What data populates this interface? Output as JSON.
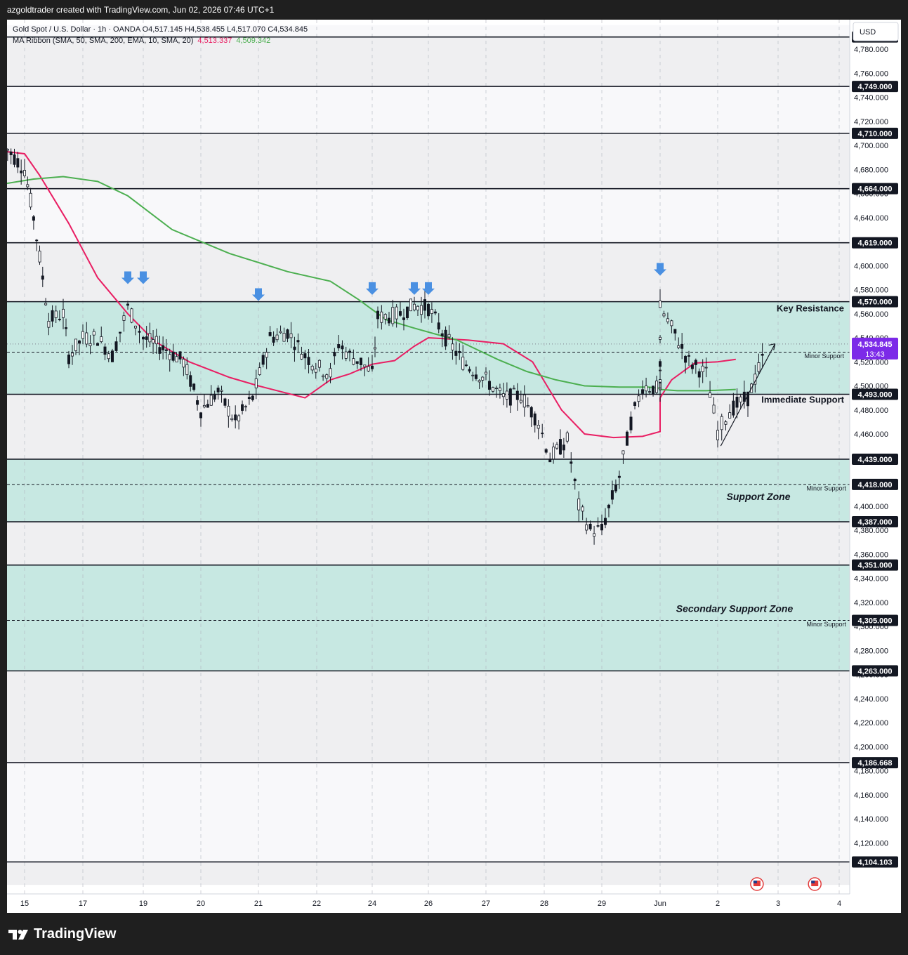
{
  "header": {
    "credit": "azgoldtrader created with TradingView.com, Jun 02, 2026 07:46 UTC+1"
  },
  "legend": {
    "symbol_line": "Gold Spot / U.S. Dollar · 1h · OANDA  O4,517.145  H4,538.455  L4,517.070  C4,534.845",
    "ribbon_label": "MA Ribbon (SMA, 50, SMA, 200, EMA, 10, SMA, 20)",
    "ma_fast_value": "4,513.337",
    "ma_slow_value": "4,509.342"
  },
  "currency": "USD",
  "brand": {
    "name": "TradingView"
  },
  "colors": {
    "zone_fill": "#c7e8e2",
    "band_light": "#f8f8fa",
    "band_dark": "#efeff1",
    "level_line": "#131722",
    "ma_fast": "#e91e63",
    "ma_slow": "#4caf50",
    "candle": "#131722",
    "arrow": "#4a90e2",
    "price_tag": "#7c2ae8"
  },
  "chart_data": {
    "type": "candlestick",
    "title": "Gold Spot / U.S. Dollar · 1h · OANDA",
    "ylabel": "USD",
    "ylim": [
      4085,
      4800
    ],
    "x_ticks": [
      "15",
      "17",
      "19",
      "20",
      "21",
      "22",
      "24",
      "26",
      "27",
      "28",
      "29",
      "Jun",
      "2",
      "3",
      "4"
    ],
    "y_ticks": [
      4120,
      4140,
      4160,
      4180,
      4200,
      4220,
      4240,
      4260,
      4280,
      4300,
      4320,
      4340,
      4360,
      4380,
      4400,
      4420,
      4440,
      4460,
      4480,
      4500,
      4520,
      4540,
      4560,
      4580,
      4600,
      4620,
      4640,
      4660,
      4680,
      4700,
      4720,
      4740,
      4760,
      4780
    ],
    "levels": [
      {
        "value": 4790.138,
        "label": "4,790.138",
        "style": "solid"
      },
      {
        "value": 4749.0,
        "label": "4,749.000",
        "style": "solid"
      },
      {
        "value": 4710.0,
        "label": "4,710.000",
        "style": "solid"
      },
      {
        "value": 4664.0,
        "label": "4,664.000",
        "style": "solid"
      },
      {
        "value": 4619.0,
        "label": "4,619.000",
        "style": "solid"
      },
      {
        "value": 4570.0,
        "label": "4,570.000",
        "style": "solid"
      },
      {
        "value": 4528.0,
        "label": "4,528.000",
        "style": "dashed"
      },
      {
        "value": 4493.0,
        "label": "4,493.000",
        "style": "solid"
      },
      {
        "value": 4439.0,
        "label": "4,439.000",
        "style": "solid"
      },
      {
        "value": 4418.0,
        "label": "4,418.000",
        "style": "dashed"
      },
      {
        "value": 4387.0,
        "label": "4,387.000",
        "style": "solid"
      },
      {
        "value": 4351.0,
        "label": "4,351.000",
        "style": "solid"
      },
      {
        "value": 4305.0,
        "label": "4,305.000",
        "style": "dashed"
      },
      {
        "value": 4263.0,
        "label": "4,263.000",
        "style": "solid"
      },
      {
        "value": 4186.668,
        "label": "4,186.668",
        "style": "solid"
      },
      {
        "value": 4104.103,
        "label": "4,104.103",
        "style": "solid"
      }
    ],
    "zones": [
      {
        "from": 4493,
        "to": 4570
      },
      {
        "from": 4387,
        "to": 4439
      },
      {
        "from": 4263,
        "to": 4351
      }
    ],
    "current_price": {
      "value": 4534.845,
      "label": "4,534.845",
      "countdown": "13:43"
    },
    "annotations": [
      {
        "text": "Key Resistance",
        "price": 4562
      },
      {
        "text": "Minor Support",
        "price": 4523
      },
      {
        "text": "Immediate Support",
        "price": 4486
      },
      {
        "text": "Support Zone",
        "price": 4405
      },
      {
        "text": "Minor Support",
        "price": 4413
      },
      {
        "text": "Secondary Support Zone",
        "price": 4312
      },
      {
        "text": "Minor Support",
        "price": 4300
      }
    ],
    "resistance_arrows": [
      {
        "date": "18.5",
        "price": 4587
      },
      {
        "date": "19",
        "price": 4587
      },
      {
        "date": "21",
        "price": 4573
      },
      {
        "date": "24",
        "price": 4578
      },
      {
        "date": "25.5",
        "price": 4578
      },
      {
        "date": "26",
        "price": 4578
      },
      {
        "date": "30",
        "price": 4594
      }
    ],
    "series": [
      {
        "name": "MA Ribbon 1",
        "points": [
          [
            14.7,
            4695
          ],
          [
            15.0,
            4693
          ],
          [
            15.5,
            4675
          ],
          [
            16.5,
            4635
          ],
          [
            17.5,
            4590
          ],
          [
            18.5,
            4560
          ],
          [
            19.2,
            4537
          ],
          [
            19.8,
            4520
          ],
          [
            20.5,
            4507
          ],
          [
            21.0,
            4500
          ],
          [
            21.8,
            4490
          ],
          [
            22.5,
            4505
          ],
          [
            23.2,
            4510
          ],
          [
            24.0,
            4518
          ],
          [
            24.8,
            4521
          ],
          [
            25.5,
            4533
          ],
          [
            26.0,
            4540
          ],
          [
            26.7,
            4538
          ],
          [
            27.3,
            4535
          ],
          [
            27.8,
            4520
          ],
          [
            28.3,
            4480
          ],
          [
            28.7,
            4460
          ],
          [
            29.2,
            4457
          ],
          [
            29.7,
            4458
          ],
          [
            30.0,
            4462
          ],
          [
            30.4,
            4475
          ],
          [
            30.8,
            4490
          ],
          [
            31.2,
            4505
          ],
          [
            31.6,
            4519
          ],
          [
            32.0,
            4520
          ],
          [
            32.3,
            4522
          ]
        ]
      },
      {
        "name": "MA Ribbon 2",
        "points": [
          [
            14.7,
            4668
          ],
          [
            15.3,
            4672
          ],
          [
            16.3,
            4674
          ],
          [
            17.5,
            4670
          ],
          [
            18.5,
            4658
          ],
          [
            19.5,
            4630
          ],
          [
            20.5,
            4610
          ],
          [
            21.5,
            4595
          ],
          [
            22.5,
            4587
          ],
          [
            23.5,
            4572
          ],
          [
            24.5,
            4555
          ],
          [
            25.5,
            4548
          ],
          [
            26.5,
            4538
          ],
          [
            27.2,
            4522
          ],
          [
            27.7,
            4512
          ],
          [
            28.2,
            4505
          ],
          [
            28.7,
            4500
          ],
          [
            29.3,
            4499
          ],
          [
            29.8,
            4499
          ],
          [
            30.3,
            4498
          ],
          [
            30.8,
            4497
          ],
          [
            31.3,
            4496
          ],
          [
            31.8,
            4496
          ],
          [
            32.3,
            4497
          ]
        ]
      }
    ],
    "candles_summary": [
      [
        14.7,
        4700
      ],
      [
        15.0,
        4680
      ],
      [
        15.3,
        4640
      ],
      [
        15.6,
        4590
      ],
      [
        15.8,
        4555
      ],
      [
        16.3,
        4560
      ],
      [
        16.5,
        4525
      ],
      [
        17.0,
        4540
      ],
      [
        17.5,
        4540
      ],
      [
        18.0,
        4525
      ],
      [
        18.5,
        4565
      ],
      [
        19.0,
        4540
      ],
      [
        19.4,
        4530
      ],
      [
        19.7,
        4520
      ],
      [
        20.0,
        4480
      ],
      [
        20.3,
        4495
      ],
      [
        20.6,
        4470
      ],
      [
        20.9,
        4490
      ],
      [
        21.2,
        4540
      ],
      [
        21.5,
        4545
      ],
      [
        21.8,
        4525
      ],
      [
        22.1,
        4515
      ],
      [
        22.5,
        4510
      ],
      [
        22.8,
        4535
      ],
      [
        23.2,
        4525
      ],
      [
        23.6,
        4520
      ],
      [
        24.0,
        4510
      ],
      [
        24.2,
        4557
      ],
      [
        24.6,
        4558
      ],
      [
        25.0,
        4560
      ],
      [
        25.5,
        4567
      ],
      [
        26.0,
        4565
      ],
      [
        26.3,
        4540
      ],
      [
        26.6,
        4520
      ],
      [
        27.0,
        4505
      ],
      [
        27.3,
        4490
      ],
      [
        27.6,
        4492
      ],
      [
        27.9,
        4470
      ],
      [
        28.1,
        4440
      ],
      [
        28.4,
        4455
      ],
      [
        28.6,
        4400
      ],
      [
        28.8,
        4380
      ],
      [
        29.0,
        4380
      ],
      [
        29.3,
        4425
      ],
      [
        29.5,
        4470
      ],
      [
        29.7,
        4500
      ],
      [
        30.0,
        4497
      ],
      [
        30.3,
        4500
      ],
      [
        30.6,
        4520
      ],
      [
        30.9,
        4565
      ],
      [
        31.2,
        4548
      ],
      [
        31.5,
        4520
      ],
      [
        31.8,
        4510
      ],
      [
        32.0,
        4462
      ],
      [
        32.2,
        4480
      ],
      [
        32.5,
        4490
      ],
      [
        32.8,
        4530
      ]
    ]
  }
}
